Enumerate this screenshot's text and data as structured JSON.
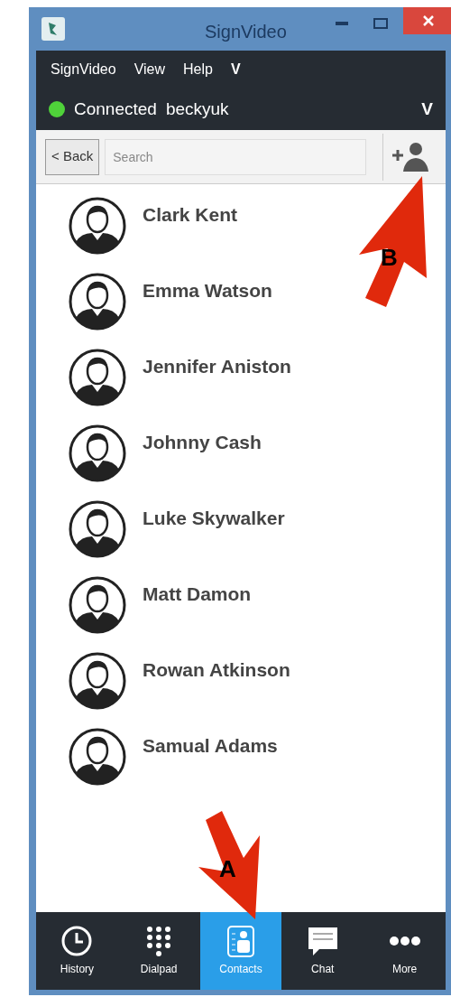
{
  "window": {
    "title": "SignVideo"
  },
  "menu": [
    "SignVideo",
    "View",
    "Help",
    "V"
  ],
  "status": {
    "connected": true,
    "label": "Connected",
    "username": "beckyuk",
    "toggle": "V"
  },
  "toolbar": {
    "back": "< Back",
    "search": {
      "placeholder": "Search"
    }
  },
  "contacts": [
    {
      "name": "Clark Kent"
    },
    {
      "name": "Emma Watson"
    },
    {
      "name": "Jennifer Aniston"
    },
    {
      "name": "Johnny Cash"
    },
    {
      "name": "Luke Skywalker"
    },
    {
      "name": "Matt Damon"
    },
    {
      "name": "Rowan Atkinson"
    },
    {
      "name": "Samual Adams"
    }
  ],
  "nav": [
    {
      "label": "History",
      "kind": "history",
      "selected": false
    },
    {
      "label": "Dialpad",
      "kind": "dialpad",
      "selected": false
    },
    {
      "label": "Contacts",
      "kind": "contacts",
      "selected": true
    },
    {
      "label": "Chat",
      "kind": "chat",
      "selected": false
    },
    {
      "label": "More",
      "kind": "more",
      "selected": false
    }
  ],
  "annotations": [
    {
      "label": "A"
    },
    {
      "label": "B"
    }
  ]
}
